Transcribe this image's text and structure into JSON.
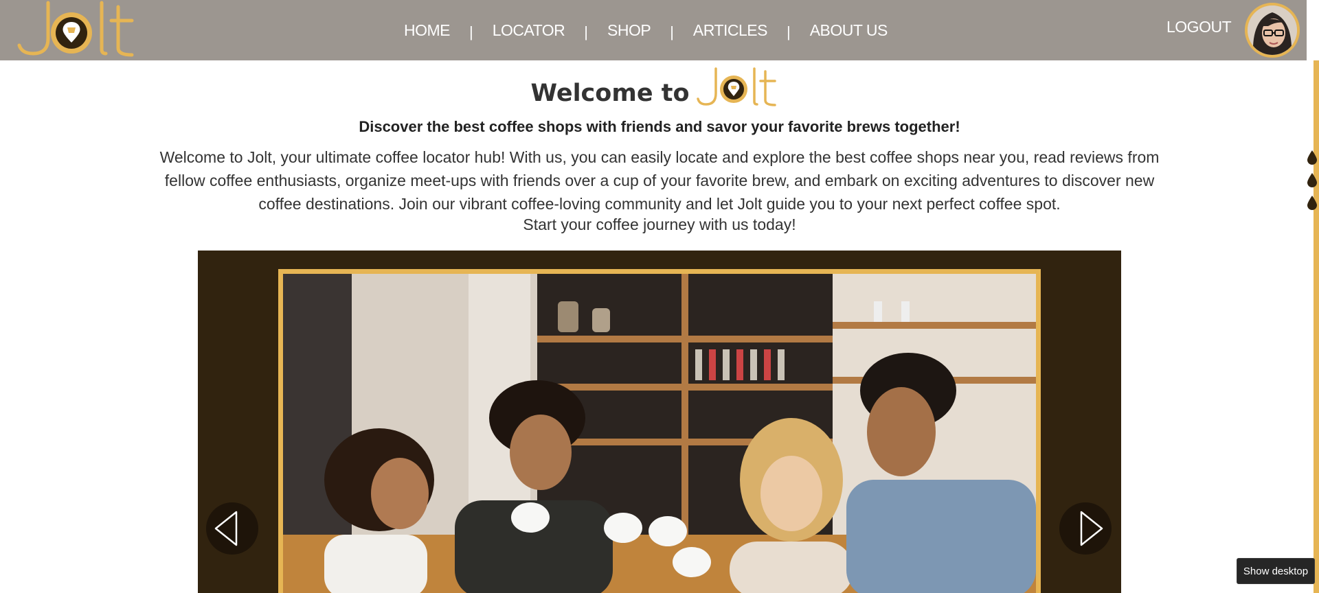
{
  "brand": {
    "name": "Jolt",
    "accent": "#e6b554",
    "nav_bg": "#9c9690",
    "dark_brown": "#31230f"
  },
  "nav": {
    "items": [
      {
        "label": "HOME"
      },
      {
        "label": "LOCATOR"
      },
      {
        "label": "SHOP"
      },
      {
        "label": "ARTICLES"
      },
      {
        "label": "ABOUT US"
      }
    ],
    "separator": "|",
    "logout_label": "LOGOUT"
  },
  "hero": {
    "welcome_text": "Welcome to",
    "subtitle": "Discover the best coffee shops with friends and savor your favorite brews together!",
    "intro": "Welcome to Jolt, your ultimate coffee locator hub! With us, you can easily locate and explore the best coffee shops near you, read reviews from fellow coffee enthusiasts, organize meet-ups with friends over a cup of your favorite brew, and embark on exciting adventures to discover new coffee destinations. Join our vibrant coffee-loving community and let Jolt guide you to your next perfect coffee spot.",
    "intro_cta": "Start your coffee journey with us today!"
  },
  "icons": {
    "prev": "chevron-left-icon",
    "next": "chevron-right-icon",
    "drop": "coffee-drop-icon"
  },
  "taskbar": {
    "show_desktop_label": "Show desktop"
  }
}
